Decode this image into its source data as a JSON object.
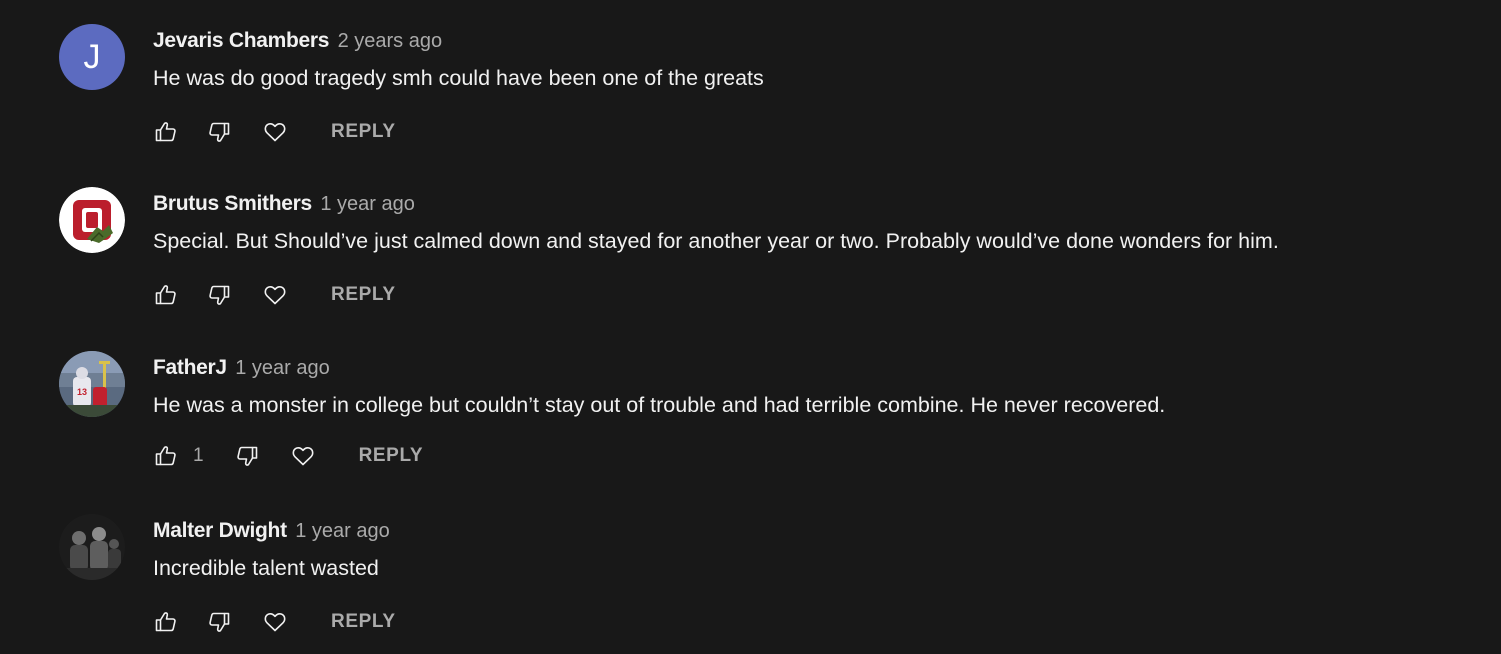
{
  "comments": [
    {
      "author": "Jevaris Chambers",
      "time": "2 years ago",
      "text": "He was do good tragedy smh could have been one of the greats",
      "avatar": {
        "type": "letter",
        "letter": "J",
        "color": "#5c6bc0"
      },
      "like_count": "",
      "reply_label": "REPLY"
    },
    {
      "author": "Brutus Smithers",
      "time": "1 year ago",
      "text": "Special. But Should’ve just calmed down and stayed for another year or two. Probably would’ve done wonders for him.",
      "avatar": {
        "type": "image",
        "icon": "block-o-logo-icon"
      },
      "like_count": "",
      "reply_label": "REPLY"
    },
    {
      "author": "FatherJ",
      "time": "1 year ago",
      "text": "He was a monster in college but couldn’t stay out of trouble and had terrible combine. He never recovered.",
      "avatar": {
        "type": "image",
        "icon": "football-photo-icon"
      },
      "like_count": "1",
      "reply_label": "REPLY"
    },
    {
      "author": "Malter Dwight",
      "time": "1 year ago",
      "text": "Incredible talent wasted",
      "avatar": {
        "type": "image",
        "icon": "group-photo-icon"
      },
      "like_count": "",
      "reply_label": "REPLY"
    }
  ],
  "icons": {
    "like": "thumb-up-icon",
    "dislike": "thumb-down-icon",
    "heart": "heart-icon"
  },
  "colors": {
    "background": "#181818",
    "primary_text": "#f1f1f1",
    "secondary_text": "#aaaaaa"
  }
}
